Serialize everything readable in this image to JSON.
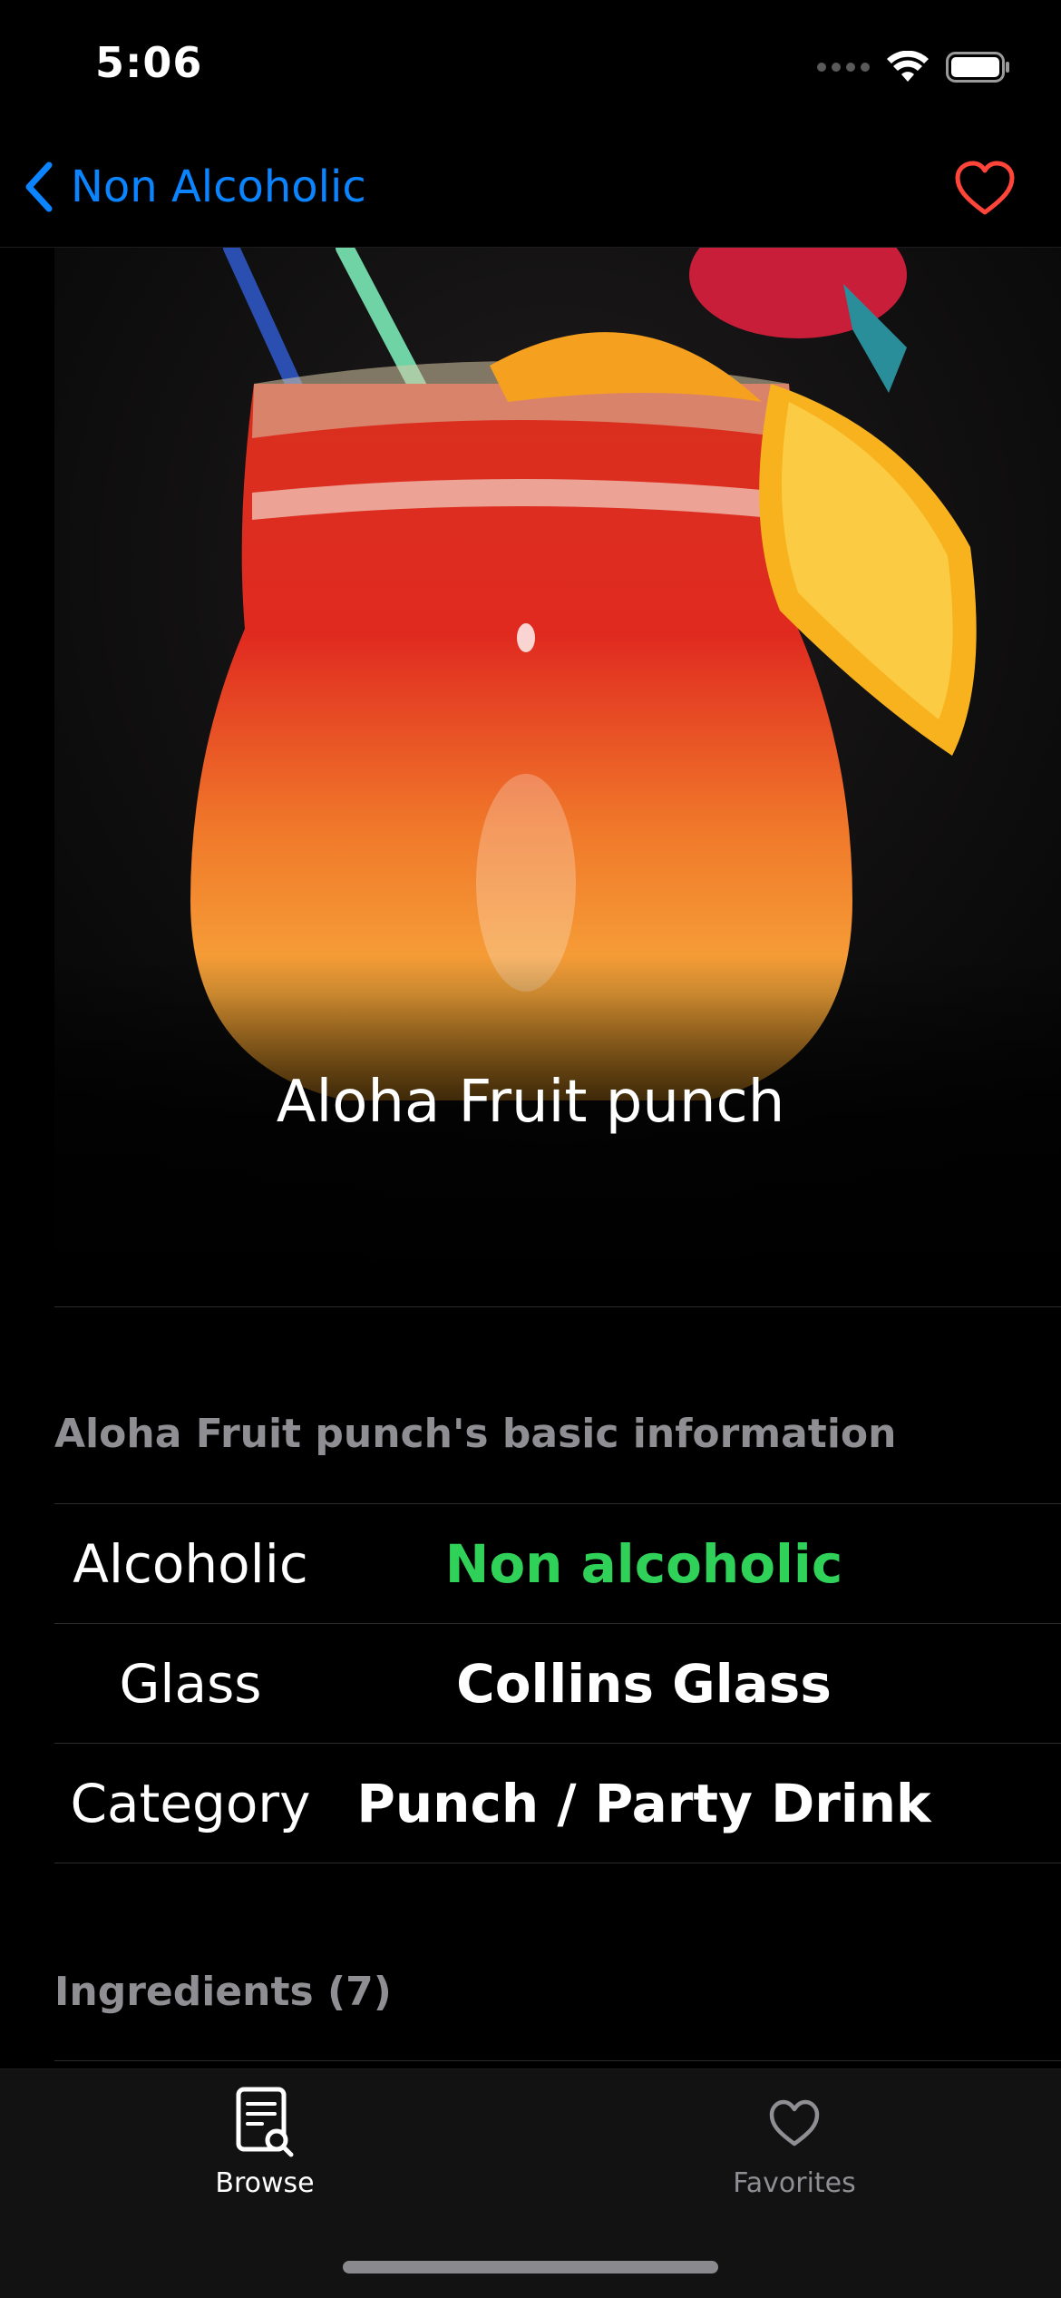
{
  "status_bar": {
    "time": "5:06"
  },
  "nav": {
    "back_label": "Non Alcoholic",
    "accent_color": "#0a84ff",
    "favorite_color": "#ff453a"
  },
  "drink": {
    "title": "Aloha Fruit punch"
  },
  "basic_info": {
    "header": "Aloha Fruit punch's basic information",
    "rows": [
      {
        "label": "Alcoholic",
        "value": "Non alcoholic",
        "value_color": "#30d158"
      },
      {
        "label": "Glass",
        "value": "Collins Glass"
      },
      {
        "label": "Category",
        "value": "Punch / Party Drink"
      }
    ]
  },
  "ingredients": {
    "header": "Ingredients (7)"
  },
  "tab_bar": {
    "tabs": [
      {
        "label": "Browse",
        "icon": "browse-document-search-icon",
        "selected": true
      },
      {
        "label": "Favorites",
        "icon": "heart-icon",
        "selected": false
      }
    ]
  }
}
